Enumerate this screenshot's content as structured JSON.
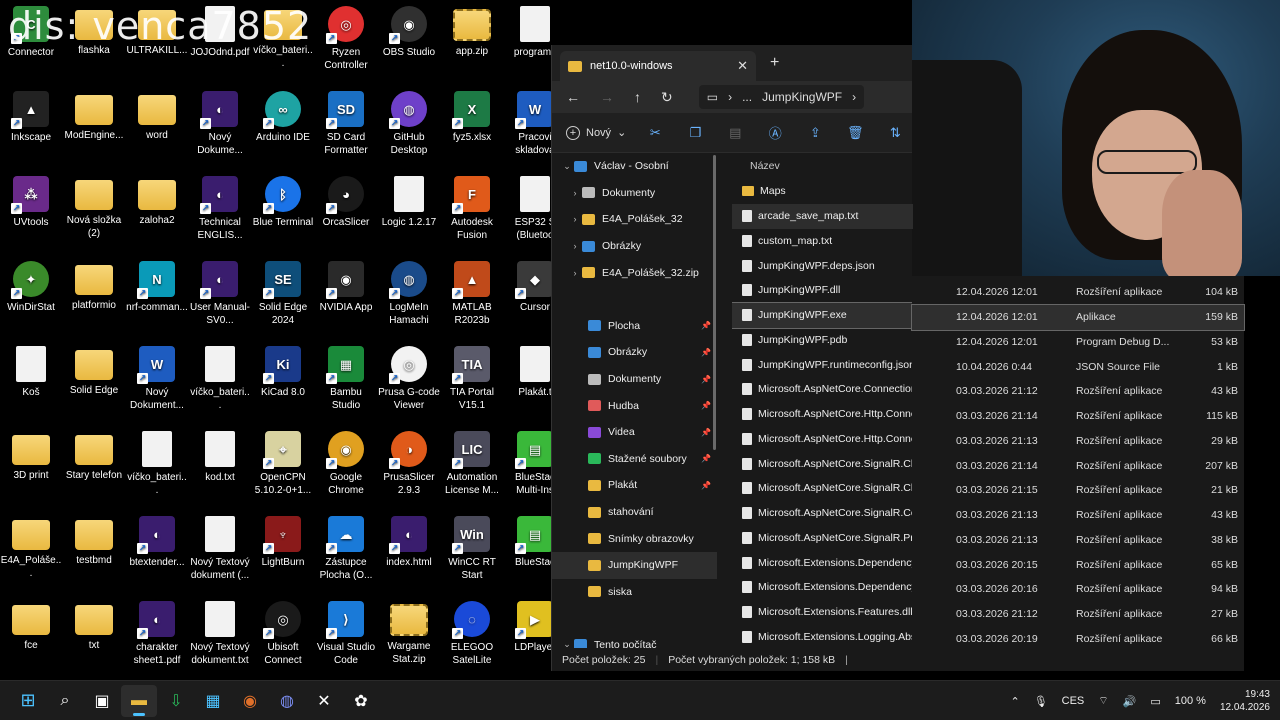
{
  "watermark": "dis: venca7852",
  "desktop": {
    "icons": [
      {
        "label": "Connector",
        "kind": "app",
        "color": "#2d8c3c",
        "glyph": "C"
      },
      {
        "label": "flashka",
        "kind": "folder"
      },
      {
        "label": "ULTRAKILL...",
        "kind": "folder"
      },
      {
        "label": "JOJOdnd.pdf",
        "kind": "doc"
      },
      {
        "label": "víčko_bateri...",
        "kind": "folder"
      },
      {
        "label": "Ryzen Controller",
        "kind": "round",
        "color": "#e03030",
        "glyph": "◎"
      },
      {
        "label": "OBS Studio",
        "kind": "round",
        "color": "#303030",
        "glyph": "◉"
      },
      {
        "label": "app.zip",
        "kind": "zip"
      },
      {
        "label": "programk",
        "kind": "doc"
      },
      {
        "label": "Inkscape",
        "kind": "app",
        "color": "#222",
        "glyph": "▲"
      },
      {
        "label": "ModEngine...",
        "kind": "folder"
      },
      {
        "label": "word",
        "kind": "folder"
      },
      {
        "label": "Nový Dokume...",
        "kind": "app",
        "color": "#3a1d6e",
        "glyph": "◐"
      },
      {
        "label": "Arduino IDE",
        "kind": "round",
        "color": "#1ea3a3",
        "glyph": "∞"
      },
      {
        "label": "SD Card Formatter",
        "kind": "app",
        "color": "#1a6fc4",
        "glyph": "SD"
      },
      {
        "label": "GitHub Desktop",
        "kind": "round",
        "color": "#6e40c9",
        "glyph": "◍"
      },
      {
        "label": "fyz5.xlsx",
        "kind": "app",
        "color": "#1d7a45",
        "glyph": "X"
      },
      {
        "label": "Pracovi skladova",
        "kind": "app",
        "color": "#1e5cc0",
        "glyph": "W"
      },
      {
        "label": "UVtools",
        "kind": "app",
        "color": "#6a2a8a",
        "glyph": "⁂"
      },
      {
        "label": "Nová složka (2)",
        "kind": "folder"
      },
      {
        "label": "zaloha2",
        "kind": "folder"
      },
      {
        "label": "Technical ENGLIS...",
        "kind": "app",
        "color": "#3a1d6e",
        "glyph": "◐"
      },
      {
        "label": "Blue Terminal",
        "kind": "round",
        "color": "#1a73e8",
        "glyph": "ᛒ"
      },
      {
        "label": "OrcaSlicer",
        "kind": "round",
        "color": "#1a1a1a",
        "glyph": "◕"
      },
      {
        "label": "Logic 1.2.17",
        "kind": "doc"
      },
      {
        "label": "Autodesk Fusion",
        "kind": "app",
        "color": "#e05a1a",
        "glyph": "F"
      },
      {
        "label": "ESP32 S (Bluetoo",
        "kind": "doc"
      },
      {
        "label": "WinDirStat",
        "kind": "round",
        "color": "#3a8a2a",
        "glyph": "✦"
      },
      {
        "label": "platformio",
        "kind": "folder"
      },
      {
        "label": "nrf-comman...",
        "kind": "app",
        "color": "#0a9ab8",
        "glyph": "N"
      },
      {
        "label": "User Manual-SV0...",
        "kind": "app",
        "color": "#3a1d6e",
        "glyph": "◐"
      },
      {
        "label": "Solid Edge 2024",
        "kind": "app",
        "color": "#0e4e7a",
        "glyph": "SE"
      },
      {
        "label": "NVIDIA App",
        "kind": "app",
        "color": "#2a2a2a",
        "glyph": "◉"
      },
      {
        "label": "LogMeIn Hamachi",
        "kind": "round",
        "color": "#1a4b8a",
        "glyph": "◍"
      },
      {
        "label": "MATLAB R2023b",
        "kind": "app",
        "color": "#c04a1a",
        "glyph": "▲"
      },
      {
        "label": "Cursor",
        "kind": "app",
        "color": "#3a3a3a",
        "glyph": "◆"
      },
      {
        "label": "Koš",
        "kind": "doc"
      },
      {
        "label": "Solid Edge",
        "kind": "folder"
      },
      {
        "label": "Nový Dokument...",
        "kind": "app",
        "color": "#1e5cc0",
        "glyph": "W"
      },
      {
        "label": "víčko_bateri...",
        "kind": "doc"
      },
      {
        "label": "KiCad 8.0",
        "kind": "app",
        "color": "#1a3a8a",
        "glyph": "Ki"
      },
      {
        "label": "Bambu Studio",
        "kind": "app",
        "color": "#1a8a3a",
        "glyph": "▦"
      },
      {
        "label": "Prusa G-code Viewer",
        "kind": "round",
        "color": "#f2f2f2",
        "glyph": "◎"
      },
      {
        "label": "TIA Portal V15.1",
        "kind": "app",
        "color": "#5a5a6a",
        "glyph": "TIA"
      },
      {
        "label": "Plakát.t",
        "kind": "doc"
      },
      {
        "label": "3D print",
        "kind": "folder"
      },
      {
        "label": "Stary telefon",
        "kind": "folder"
      },
      {
        "label": "víčko_bateri...",
        "kind": "doc"
      },
      {
        "label": "kod.txt",
        "kind": "doc"
      },
      {
        "label": "OpenCPN 5.10.2-0+1...",
        "kind": "app",
        "color": "#d8d2a0",
        "glyph": "⌖"
      },
      {
        "label": "Google Chrome",
        "kind": "round",
        "color": "#e0a020",
        "glyph": "◉"
      },
      {
        "label": "PrusaSlicer 2.9.3",
        "kind": "round",
        "color": "#e05a1a",
        "glyph": "◑"
      },
      {
        "label": "Automation License M...",
        "kind": "app",
        "color": "#4a4a5a",
        "glyph": "LIC"
      },
      {
        "label": "BlueStac Multi-Ins",
        "kind": "app",
        "color": "#3ab83a",
        "glyph": "▤"
      },
      {
        "label": "E4A_Poláše...",
        "kind": "folder"
      },
      {
        "label": "testbmd",
        "kind": "folder"
      },
      {
        "label": "btextender...",
        "kind": "app",
        "color": "#3a1d6e",
        "glyph": "◐"
      },
      {
        "label": "Nový Textový dokument (...",
        "kind": "doc"
      },
      {
        "label": "LightBurn",
        "kind": "app",
        "color": "#8a1a1a",
        "glyph": "♆"
      },
      {
        "label": "Zástupce Plocha (O...",
        "kind": "app",
        "color": "#1a7ad8",
        "glyph": "☁"
      },
      {
        "label": "index.html",
        "kind": "app",
        "color": "#3a1d6e",
        "glyph": "◐"
      },
      {
        "label": "WinCC RT Start",
        "kind": "app",
        "color": "#4a4a5a",
        "glyph": "Win"
      },
      {
        "label": "BlueStac",
        "kind": "app",
        "color": "#3ab83a",
        "glyph": "▤"
      },
      {
        "label": "fce",
        "kind": "folder"
      },
      {
        "label": "txt",
        "kind": "folder"
      },
      {
        "label": "charakter sheet1.pdf",
        "kind": "app",
        "color": "#3a1d6e",
        "glyph": "◐"
      },
      {
        "label": "Nový Textový dokument.txt",
        "kind": "doc"
      },
      {
        "label": "Ubisoft Connect",
        "kind": "round",
        "color": "#1a1a1a",
        "glyph": "◎"
      },
      {
        "label": "Visual Studio Code",
        "kind": "app",
        "color": "#1a7ad8",
        "glyph": "⟩"
      },
      {
        "label": "Wargame Stat.zip",
        "kind": "zip"
      },
      {
        "label": "ELEGOO SatelLite",
        "kind": "round",
        "color": "#1a4ad8",
        "glyph": "◌"
      },
      {
        "label": "LDPlayer",
        "kind": "app",
        "color": "#e0c020",
        "glyph": "▶"
      }
    ]
  },
  "explorer": {
    "tab_title": "net10.0-windows",
    "breadcrumb_ellipsis": "...",
    "breadcrumb_current": "JumpKingWPF",
    "new_label": "Nový",
    "nav": [
      {
        "label": "Václav - Osobní",
        "expand": "⌄",
        "color": "#3a8ad8",
        "pinned": false,
        "sel": false
      },
      {
        "label": "Dokumenty",
        "expand": "›",
        "color": "#bbbbbb",
        "pinned": false,
        "sel": false
      },
      {
        "label": "E4A_Polášek_32",
        "expand": "›",
        "color": "#e9b940",
        "pinned": false,
        "sel": false
      },
      {
        "label": "Obrázky",
        "expand": "›",
        "color": "#3a8ad8",
        "pinned": false,
        "sel": false
      },
      {
        "label": "E4A_Polášek_32.zip",
        "expand": "›",
        "color": "#e9b940",
        "pinned": false,
        "sel": false
      },
      {
        "label": "",
        "expand": "",
        "color": "",
        "pinned": false,
        "sel": false
      },
      {
        "label": "Plocha",
        "expand": "",
        "color": "#3a8ad8",
        "pinned": true,
        "sel": false
      },
      {
        "label": "Obrázky",
        "expand": "",
        "color": "#3a8ad8",
        "pinned": true,
        "sel": false
      },
      {
        "label": "Dokumenty",
        "expand": "",
        "color": "#bbbbbb",
        "pinned": true,
        "sel": false
      },
      {
        "label": "Hudba",
        "expand": "",
        "color": "#e05a5a",
        "pinned": true,
        "sel": false
      },
      {
        "label": "Videa",
        "expand": "",
        "color": "#8a4ad8",
        "pinned": true,
        "sel": false
      },
      {
        "label": "Stažené soubory",
        "expand": "",
        "color": "#2ab85a",
        "pinned": true,
        "sel": false
      },
      {
        "label": "Plakát",
        "expand": "",
        "color": "#e9b940",
        "pinned": true,
        "sel": false
      },
      {
        "label": "stahování",
        "expand": "",
        "color": "#e9b940",
        "pinned": false,
        "sel": false
      },
      {
        "label": "Snímky obrazovky",
        "expand": "",
        "color": "#e9b940",
        "pinned": false,
        "sel": false
      },
      {
        "label": "JumpKingWPF",
        "expand": "",
        "color": "#e9b940",
        "pinned": false,
        "sel": true
      },
      {
        "label": "siska",
        "expand": "",
        "color": "#e9b940",
        "pinned": false,
        "sel": false
      },
      {
        "label": "",
        "expand": "",
        "color": "",
        "pinned": false,
        "sel": false
      },
      {
        "label": "Tento počítač",
        "expand": "⌄",
        "color": "#3a8ad8",
        "pinned": false,
        "sel": false
      }
    ],
    "col_name": "Název",
    "files": [
      {
        "name": "Maps",
        "folder": true,
        "date": "",
        "type": "",
        "size": ""
      },
      {
        "name": "arcade_save_map.txt",
        "folder": false,
        "date": "",
        "type": "",
        "size": ""
      },
      {
        "name": "custom_map.txt",
        "folder": false,
        "date": "",
        "type": "",
        "size": ""
      },
      {
        "name": "JumpKingWPF.deps.json",
        "folder": false,
        "date": "",
        "type": "",
        "size": ""
      },
      {
        "name": "JumpKingWPF.dll",
        "folder": false,
        "date": "12.04.2026 12:01",
        "type": "Rozšíření aplikace",
        "size": "104 kB"
      },
      {
        "name": "JumpKingWPF.exe",
        "folder": false,
        "date": "12.04.2026 12:01",
        "type": "Aplikace",
        "size": "159 kB"
      },
      {
        "name": "JumpKingWPF.pdb",
        "folder": false,
        "date": "12.04.2026 12:01",
        "type": "Program Debug D...",
        "size": "53 kB"
      },
      {
        "name": "JumpKingWPF.runtimeconfig.json",
        "folder": false,
        "date": "10.04.2026 0:44",
        "type": "JSON Source File",
        "size": "1 kB"
      },
      {
        "name": "Microsoft.AspNetCore.Connections.Abstr...",
        "folder": false,
        "date": "03.03.2026 21:12",
        "type": "Rozšíření aplikace",
        "size": "43 kB"
      },
      {
        "name": "Microsoft.AspNetCore.Http.Connections...",
        "folder": false,
        "date": "03.03.2026 21:14",
        "type": "Rozšíření aplikace",
        "size": "115 kB"
      },
      {
        "name": "Microsoft.AspNetCore.Http.Connections...",
        "folder": false,
        "date": "03.03.2026 21:13",
        "type": "Rozšíření aplikace",
        "size": "29 kB"
      },
      {
        "name": "Microsoft.AspNetCore.SignalR.Client.Cor...",
        "folder": false,
        "date": "03.03.2026 21:14",
        "type": "Rozšíření aplikace",
        "size": "207 kB"
      },
      {
        "name": "Microsoft.AspNetCore.SignalR.Client.dll",
        "folder": false,
        "date": "03.03.2026 21:15",
        "type": "Rozšíření aplikace",
        "size": "21 kB"
      },
      {
        "name": "Microsoft.AspNetCore.SignalR.Common...",
        "folder": false,
        "date": "03.03.2026 21:13",
        "type": "Rozšíření aplikace",
        "size": "43 kB"
      },
      {
        "name": "Microsoft.AspNetCore.SignalR.Protocols.J...",
        "folder": false,
        "date": "03.03.2026 21:13",
        "type": "Rozšíření aplikace",
        "size": "38 kB"
      },
      {
        "name": "Microsoft.Extensions.DependencyInjectio...",
        "folder": false,
        "date": "03.03.2026 20:15",
        "type": "Rozšíření aplikace",
        "size": "65 kB"
      },
      {
        "name": "Microsoft.Extensions.DependencyInjectio...",
        "folder": false,
        "date": "03.03.2026 20:16",
        "type": "Rozšíření aplikace",
        "size": "94 kB"
      },
      {
        "name": "Microsoft.Extensions.Features.dll",
        "folder": false,
        "date": "03.03.2026 21:12",
        "type": "Rozšíření aplikace",
        "size": "27 kB"
      },
      {
        "name": "Microsoft.Extensions.Logging.Abstraction...",
        "folder": false,
        "date": "03.03.2026 20:19",
        "type": "Rozšíření aplikace",
        "size": "66 kB"
      }
    ],
    "selected_index": 5,
    "hover_index": 1,
    "status_count": "Počet položek: 25",
    "status_selected": "Počet vybraných položek: 1; 158 kB"
  },
  "taskbar": {
    "lang": "CES",
    "battery": "100 %",
    "time": "19:43",
    "date": "12.04.2026"
  }
}
